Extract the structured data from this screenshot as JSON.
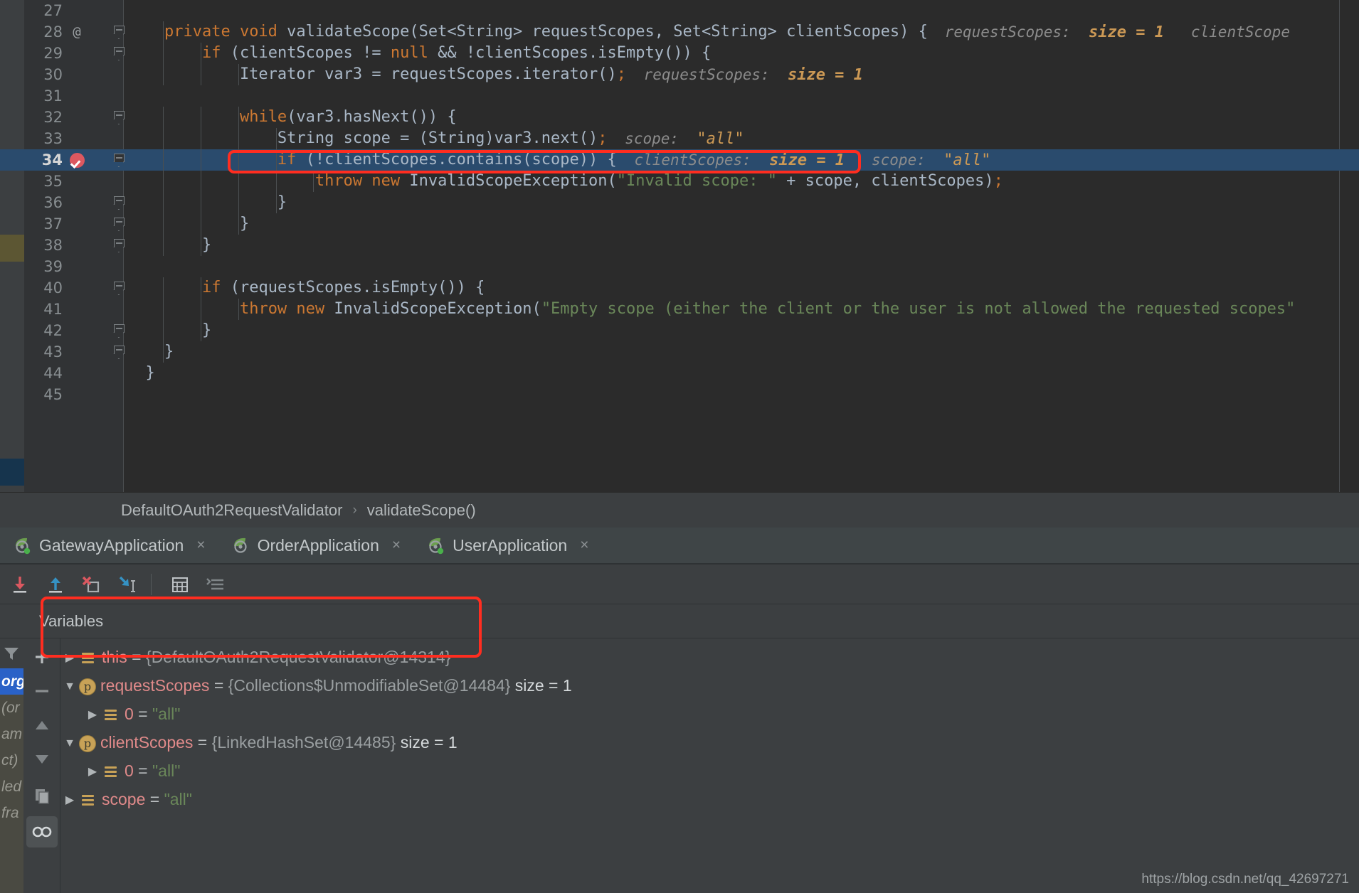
{
  "editor": {
    "first_line": 27,
    "current_line": 34,
    "lines": [
      {
        "num": 27,
        "anno": "",
        "fold": "none",
        "code": []
      },
      {
        "num": 28,
        "anno": "@",
        "fold": "start",
        "code": [
          {
            "t": "    ",
            "c": "punct"
          },
          {
            "t": "private void ",
            "c": "kw"
          },
          {
            "t": "validateScope(Set<String> requestScopes, Set<String> clientScopes) {",
            "c": "cls"
          }
        ],
        "hints": [
          {
            "label": "requestScopes:",
            "value": "size = 1"
          },
          {
            "label": "clientScope",
            "value": "",
            "truncated": true
          }
        ]
      },
      {
        "num": 29,
        "anno": "",
        "fold": "start",
        "code": [
          {
            "t": "        ",
            "c": "punct"
          },
          {
            "t": "if ",
            "c": "kw"
          },
          {
            "t": "(clientScopes != ",
            "c": "cls"
          },
          {
            "t": "null",
            "c": "kw"
          },
          {
            "t": " && !clientScopes.isEmpty()) {",
            "c": "cls"
          }
        ],
        "hints": []
      },
      {
        "num": 30,
        "anno": "",
        "fold": "none",
        "code": [
          {
            "t": "            Iterator var3 = requestScopes.iterator()",
            "c": "cls"
          },
          {
            "t": ";",
            "c": "semi"
          }
        ],
        "hints": [
          {
            "label": "requestScopes:",
            "value": "size = 1"
          }
        ]
      },
      {
        "num": 31,
        "anno": "",
        "fold": "none",
        "code": []
      },
      {
        "num": 32,
        "anno": "",
        "fold": "start",
        "code": [
          {
            "t": "            ",
            "c": "punct"
          },
          {
            "t": "while",
            "c": "kw"
          },
          {
            "t": "(var3.hasNext()) {",
            "c": "cls"
          }
        ],
        "hints": []
      },
      {
        "num": 33,
        "anno": "",
        "fold": "none",
        "code": [
          {
            "t": "                String scope = (String)var3.next()",
            "c": "cls"
          },
          {
            "t": ";",
            "c": "semi"
          }
        ],
        "hints": [
          {
            "label": "scope:",
            "value": "\"all\"",
            "isstring": true
          }
        ]
      },
      {
        "num": 34,
        "anno": "",
        "fold": "start",
        "breakpoint": true,
        "executing": true,
        "code": [
          {
            "t": "                ",
            "c": "punct"
          },
          {
            "t": "if ",
            "c": "kw"
          },
          {
            "t": "(!clientScopes.contains(scope)) {",
            "c": "cls"
          }
        ],
        "hints": [
          {
            "label": "clientScopes:",
            "value": "size = 1"
          },
          {
            "label": "scope:",
            "value": "\"all\"",
            "isstring": true
          }
        ]
      },
      {
        "num": 35,
        "anno": "",
        "fold": "none",
        "code": [
          {
            "t": "                    ",
            "c": "punct"
          },
          {
            "t": "throw new ",
            "c": "kw"
          },
          {
            "t": "InvalidScopeException(",
            "c": "cls"
          },
          {
            "t": "\"Invalid scope: \"",
            "c": "str"
          },
          {
            "t": " + scope, clientScopes)",
            "c": "cls"
          },
          {
            "t": ";",
            "c": "semi"
          }
        ],
        "hints": []
      },
      {
        "num": 36,
        "anno": "",
        "fold": "end",
        "code": [
          {
            "t": "                }",
            "c": "cls"
          }
        ],
        "hints": []
      },
      {
        "num": 37,
        "anno": "",
        "fold": "end",
        "code": [
          {
            "t": "            }",
            "c": "cls"
          }
        ],
        "hints": []
      },
      {
        "num": 38,
        "anno": "",
        "fold": "end",
        "code": [
          {
            "t": "        }",
            "c": "cls"
          }
        ],
        "hints": []
      },
      {
        "num": 39,
        "anno": "",
        "fold": "none",
        "code": []
      },
      {
        "num": 40,
        "anno": "",
        "fold": "start",
        "code": [
          {
            "t": "        ",
            "c": "punct"
          },
          {
            "t": "if ",
            "c": "kw"
          },
          {
            "t": "(requestScopes.isEmpty()) {",
            "c": "cls"
          }
        ],
        "hints": []
      },
      {
        "num": 41,
        "anno": "",
        "fold": "none",
        "code": [
          {
            "t": "            ",
            "c": "punct"
          },
          {
            "t": "throw new ",
            "c": "kw"
          },
          {
            "t": "InvalidScopeException(",
            "c": "cls"
          },
          {
            "t": "\"Empty scope (either the client or the user is not allowed the requested scopes\"",
            "c": "str"
          }
        ],
        "hints": []
      },
      {
        "num": 42,
        "anno": "",
        "fold": "end",
        "code": [
          {
            "t": "        }",
            "c": "cls"
          }
        ],
        "hints": []
      },
      {
        "num": 43,
        "anno": "",
        "fold": "end",
        "code": [
          {
            "t": "    }",
            "c": "cls"
          }
        ],
        "hints": []
      },
      {
        "num": 44,
        "anno": "",
        "fold": "none",
        "code": [
          {
            "t": "  }",
            "c": "cls"
          }
        ],
        "hints": []
      },
      {
        "num": 45,
        "anno": "",
        "fold": "none",
        "code": []
      }
    ]
  },
  "breadcrumb": {
    "class_name": "DefaultOAuth2RequestValidator",
    "separator": "›",
    "method_name": "validateScope()"
  },
  "run_tabs": [
    {
      "label": "GatewayApplication",
      "close": "×",
      "icon": "spring-leaf-icon",
      "running": true
    },
    {
      "label": "OrderApplication",
      "close": "×",
      "icon": "spring-leaf-icon",
      "running": false
    },
    {
      "label": "UserApplication",
      "close": "×",
      "icon": "spring-leaf-icon",
      "running": true
    }
  ],
  "debug_toolbar": [
    {
      "name": "step-over-button",
      "icon": "arrow-down-red"
    },
    {
      "name": "step-into-button",
      "icon": "arrow-up-blue"
    },
    {
      "name": "force-step-into-button",
      "icon": "x-red"
    },
    {
      "name": "step-out-button",
      "icon": "arrow-down-right-blue"
    },
    {
      "name": "evaluate-expression-button",
      "icon": "calculator"
    },
    {
      "name": "show-execution-point-button",
      "icon": "lines"
    }
  ],
  "variables_panel": {
    "tab_label": "Variables",
    "side_tools": [
      {
        "name": "add-watch-button",
        "icon": "plus"
      },
      {
        "name": "remove-watch-button",
        "icon": "minus"
      },
      {
        "name": "move-up-button",
        "icon": "triangle-up"
      },
      {
        "name": "move-down-button",
        "icon": "triangle-down"
      },
      {
        "name": "copy-value-button",
        "icon": "copy"
      },
      {
        "name": "mute-breakpoints-button",
        "icon": "glasses",
        "active": true
      }
    ],
    "frames_fragments": [
      "org",
      "(or",
      "am",
      "ct)",
      "led",
      "fra"
    ],
    "rows": [
      {
        "indent": 0,
        "twisty": "▶",
        "expanded": false,
        "icon": "list",
        "name": "this",
        "eq": "=",
        "type": "{DefaultOAuth2RequestValidator@14314}",
        "size": "",
        "value": "",
        "highlighted": false
      },
      {
        "indent": 0,
        "twisty": "▼",
        "expanded": true,
        "icon": "parameter",
        "name": "requestScopes",
        "eq": "=",
        "type": "{Collections$UnmodifiableSet@14484}",
        "size": "size = 1",
        "value": "",
        "highlighted": false
      },
      {
        "indent": 1,
        "twisty": "▶",
        "expanded": false,
        "icon": "list",
        "name": "0",
        "eq": "=",
        "type": "",
        "size": "",
        "value": "\"all\"",
        "highlighted": false
      },
      {
        "indent": 0,
        "twisty": "▼",
        "expanded": true,
        "icon": "parameter",
        "name": "clientScopes",
        "eq": "=",
        "type": "{LinkedHashSet@14485}",
        "size": "size = 1",
        "value": "",
        "highlighted": true
      },
      {
        "indent": 1,
        "twisty": "▶",
        "expanded": false,
        "icon": "list",
        "name": "0",
        "eq": "=",
        "type": "",
        "size": "",
        "value": "\"all\"",
        "highlighted": true
      },
      {
        "indent": 0,
        "twisty": "▶",
        "expanded": false,
        "icon": "list",
        "name": "scope",
        "eq": "=",
        "type": "",
        "size": "",
        "value": "\"all\"",
        "highlighted": false
      }
    ]
  },
  "watermark": "https://blog.csdn.net/qq_42697271",
  "colors": {
    "editor_bg": "#2b2b2b",
    "gutter_bg": "#313335",
    "panel_bg": "#3c3f41",
    "exec_line_bg": "#2a4b6d",
    "annotation_red": "#ff2d20",
    "keyword_orange": "#cc7832",
    "string_green": "#6a8759",
    "text_gray": "#a9b7c6",
    "hint_gray": "#8c8c8c",
    "hint_value": "#cc9955",
    "var_name_red": "#e08a8a",
    "breakpoint_red": "#db5860"
  }
}
